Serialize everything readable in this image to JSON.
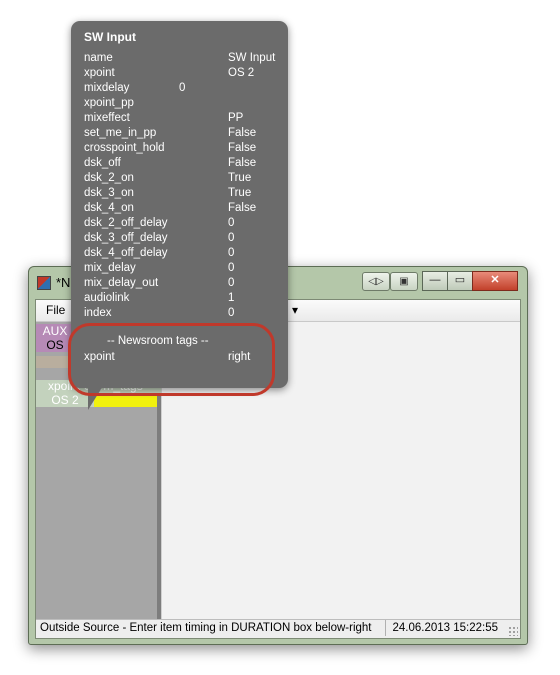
{
  "window": {
    "title": "*NE",
    "buttons": [
      "◁▷",
      "▣",
      "—",
      "▭",
      "✕"
    ]
  },
  "menu": {
    "file": "File",
    "dropdown": "▾"
  },
  "left_panel": {
    "cells": [
      {
        "text": "AUX",
        "bg": "#b68ab6"
      },
      {
        "text": "OS",
        "bg": "#b68ab6"
      },
      {
        "text": "xpoint",
        "bg": "#c3d2bd"
      },
      {
        "text": "OS 2",
        "bg": "#c3d2bd"
      }
    ],
    "yellow": "#f1f10e",
    "xpoint_right_text": "ewrm_tags"
  },
  "status": {
    "message": "Outside Source - Enter item timing in DURATION box below-right",
    "datetime": "24.06.2013 15:22:55"
  },
  "tooltip": {
    "title": "SW Input",
    "rows": [
      {
        "key": "name",
        "value": "SW Input",
        "mid": ""
      },
      {
        "key": "xpoint",
        "value": "OS 2",
        "mid": ""
      },
      {
        "key": "mixdelay",
        "value": "",
        "mid": "0"
      },
      {
        "key": "xpoint_pp",
        "value": "",
        "mid": ""
      },
      {
        "key": "mixeffect",
        "value": "PP",
        "mid": ""
      },
      {
        "key": "set_me_in_pp",
        "value": "False",
        "mid": ""
      },
      {
        "key": "crosspoint_hold",
        "value": "False",
        "mid": ""
      },
      {
        "key": "dsk_off",
        "value": "False",
        "mid": ""
      },
      {
        "key": "dsk_2_on",
        "value": "True",
        "mid": ""
      },
      {
        "key": "dsk_3_on",
        "value": "True",
        "mid": ""
      },
      {
        "key": "dsk_4_on",
        "value": "False",
        "mid": ""
      },
      {
        "key": "dsk_2_off_delay",
        "value": "0",
        "mid": ""
      },
      {
        "key": "dsk_3_off_delay",
        "value": "0",
        "mid": ""
      },
      {
        "key": "dsk_4_off_delay",
        "value": "0",
        "mid": ""
      },
      {
        "key": "mix_delay",
        "value": "0",
        "mid": ""
      },
      {
        "key": "mix_delay_out",
        "value": "0",
        "mid": ""
      },
      {
        "key": "audiolink",
        "value": "1",
        "mid": ""
      },
      {
        "key": "index",
        "value": "0",
        "mid": ""
      }
    ],
    "section": "-- Newsroom tags --",
    "tag_row": {
      "key": "xpoint",
      "value": "right"
    }
  },
  "colors": {
    "highlight": "#c0392b",
    "tooltip_bg": "#6b6b6b"
  }
}
